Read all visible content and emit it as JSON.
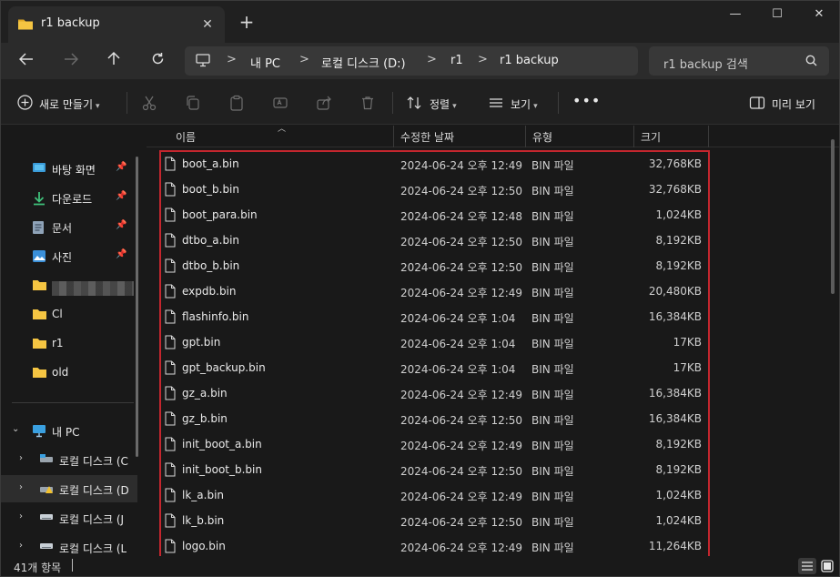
{
  "tab": {
    "title": "r1 backup",
    "close": "✕",
    "new_tab": "+"
  },
  "window_controls": {
    "minimize": "—",
    "maximize": "☐",
    "close": "✕"
  },
  "nav": {
    "breadcrumb": [
      "내 PC",
      "로컬 디스크 (D:)",
      "r1",
      "r1 backup"
    ],
    "separator": ">",
    "search_placeholder": "r1 backup 검색"
  },
  "toolbar": {
    "new_label": "새로 만들기",
    "sort_label": "정렬",
    "view_label": "보기",
    "details_pane_label": "미리 보기",
    "more": "•••"
  },
  "sidebar": {
    "quick_access": [
      {
        "label": "바탕 화면",
        "icon": "desktop-icon",
        "pinned": true
      },
      {
        "label": "다운로드",
        "icon": "download-icon",
        "pinned": true
      },
      {
        "label": "문서",
        "icon": "document-icon",
        "pinned": true
      },
      {
        "label": "사진",
        "icon": "pictures-icon",
        "pinned": true
      },
      {
        "label": "",
        "icon": "folder-icon",
        "pinned": false,
        "blurred": true
      },
      {
        "label": "Cl",
        "icon": "folder-icon",
        "pinned": false
      },
      {
        "label": "r1",
        "icon": "folder-icon",
        "pinned": false
      },
      {
        "label": "old",
        "icon": "folder-icon",
        "pinned": false
      }
    ],
    "this_pc": {
      "label": "내 PC",
      "icon": "pc-icon"
    },
    "drives": [
      {
        "label": "로컬 디스크 (C",
        "icon": "drive-icon"
      },
      {
        "label": "로컬 디스크 (D",
        "icon": "drive-warning-icon",
        "selected": true
      },
      {
        "label": "로컬 디스크 (J",
        "icon": "drive-icon"
      },
      {
        "label": "로컬 디스크 (L",
        "icon": "drive-icon"
      }
    ]
  },
  "columns": {
    "name": "이름",
    "modified": "수정한 날짜",
    "type": "유형",
    "size": "크기"
  },
  "files": [
    {
      "name": "boot_a.bin",
      "modified": "2024-06-24 오후 12:49",
      "type": "BIN 파일",
      "size": "32,768KB"
    },
    {
      "name": "boot_b.bin",
      "modified": "2024-06-24 오후 12:50",
      "type": "BIN 파일",
      "size": "32,768KB"
    },
    {
      "name": "boot_para.bin",
      "modified": "2024-06-24 오후 12:48",
      "type": "BIN 파일",
      "size": "1,024KB"
    },
    {
      "name": "dtbo_a.bin",
      "modified": "2024-06-24 오후 12:50",
      "type": "BIN 파일",
      "size": "8,192KB"
    },
    {
      "name": "dtbo_b.bin",
      "modified": "2024-06-24 오후 12:50",
      "type": "BIN 파일",
      "size": "8,192KB"
    },
    {
      "name": "expdb.bin",
      "modified": "2024-06-24 오후 12:49",
      "type": "BIN 파일",
      "size": "20,480KB"
    },
    {
      "name": "flashinfo.bin",
      "modified": "2024-06-24 오후 1:04",
      "type": "BIN 파일",
      "size": "16,384KB"
    },
    {
      "name": "gpt.bin",
      "modified": "2024-06-24 오후 1:04",
      "type": "BIN 파일",
      "size": "17KB"
    },
    {
      "name": "gpt_backup.bin",
      "modified": "2024-06-24 오후 1:04",
      "type": "BIN 파일",
      "size": "17KB"
    },
    {
      "name": "gz_a.bin",
      "modified": "2024-06-24 오후 12:49",
      "type": "BIN 파일",
      "size": "16,384KB"
    },
    {
      "name": "gz_b.bin",
      "modified": "2024-06-24 오후 12:50",
      "type": "BIN 파일",
      "size": "16,384KB"
    },
    {
      "name": "init_boot_a.bin",
      "modified": "2024-06-24 오후 12:49",
      "type": "BIN 파일",
      "size": "8,192KB"
    },
    {
      "name": "init_boot_b.bin",
      "modified": "2024-06-24 오후 12:50",
      "type": "BIN 파일",
      "size": "8,192KB"
    },
    {
      "name": "lk_a.bin",
      "modified": "2024-06-24 오후 12:49",
      "type": "BIN 파일",
      "size": "1,024KB"
    },
    {
      "name": "lk_b.bin",
      "modified": "2024-06-24 오후 12:50",
      "type": "BIN 파일",
      "size": "1,024KB"
    },
    {
      "name": "logo.bin",
      "modified": "2024-06-24 오후 12:49",
      "type": "BIN 파일",
      "size": "11,264KB"
    }
  ],
  "status": {
    "item_count": "41개 항목"
  },
  "colors": {
    "accent": "#4cc2ff",
    "folder": "#f5c542",
    "highlight": "#c4262e"
  }
}
